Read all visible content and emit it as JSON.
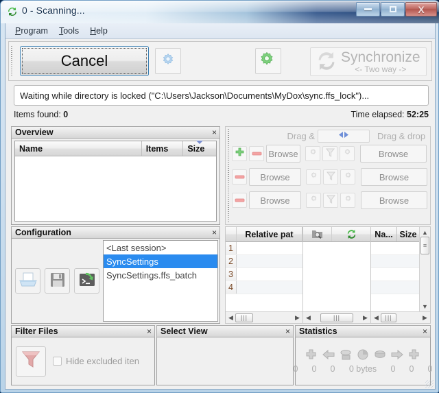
{
  "window": {
    "title": "0 - Scanning...",
    "icon": "sync-arrows-icon",
    "buttons": {
      "minimize": "minimize-button",
      "maximize": "maximize-button",
      "close_label": "X"
    }
  },
  "menubar": {
    "items": [
      {
        "label": "Program",
        "accel": "P"
      },
      {
        "label": "Tools",
        "accel": "T"
      },
      {
        "label": "Help",
        "accel": "H"
      }
    ]
  },
  "toolbar": {
    "cancel_label": "Cancel",
    "compare_settings_icon": "blue-gear-icon",
    "sync_settings_icon": "green-gear-icon",
    "synchronize_label": "Synchronize",
    "synchronize_sub": "<- Two way ->"
  },
  "status": {
    "message": "Waiting while directory is locked (\"C:\\Users\\Jackson\\Documents\\MyDox\\sync.ffs_lock\")...",
    "items_found_label": "Items found:",
    "items_found_value": "0",
    "time_elapsed_label": "Time elapsed:",
    "time_elapsed_value": "52:25"
  },
  "overview": {
    "caption": "Overview",
    "close": "×",
    "columns": [
      "Name",
      "Items",
      "Size"
    ],
    "sort_column": "Size",
    "rows": []
  },
  "dragdrop": {
    "left_hint": "Drag &",
    "right_hint": "Drag & drop",
    "swap_icon": "swap-left-right-icon",
    "rows": [
      {
        "add_icon": "green-plus-icon",
        "remove_icon": "red-minus-icon",
        "left_browse": "Browse",
        "mid_icons": [
          "gear-icon",
          "filter-icon",
          "gear-icon"
        ],
        "right_browse": "Browse"
      },
      {
        "remove_icon": "red-minus-icon",
        "left_browse": "Browse",
        "mid_icons": [
          "gear-icon",
          "filter-icon",
          "gear-icon"
        ],
        "right_browse": "Browse"
      },
      {
        "remove_icon": "red-minus-icon",
        "left_browse": "Browse",
        "mid_icons": [
          "gear-icon",
          "filter-icon",
          "gear-icon"
        ],
        "right_browse": "Browse"
      }
    ]
  },
  "configuration": {
    "caption": "Configuration",
    "close": "×",
    "buttons": [
      {
        "icon": "open-config-icon"
      },
      {
        "icon": "save-config-icon"
      },
      {
        "icon": "save-batch-job-icon"
      }
    ],
    "list": [
      {
        "label": "<Last session>",
        "selected": false
      },
      {
        "label": "SyncSettings",
        "selected": true
      },
      {
        "label": "SyncSettings.ffs_batch",
        "selected": false
      }
    ]
  },
  "grids": {
    "left": {
      "header": "Relative pat",
      "row_numbers": [
        "1",
        "2",
        "3",
        "4"
      ]
    },
    "middle": {
      "header_icons": [
        "select-folder-icon",
        "sync-direction-icon"
      ]
    },
    "right": {
      "headers": [
        "Na...",
        "Size"
      ]
    }
  },
  "filter": {
    "caption": "Filter Files",
    "close": "×",
    "icon": "funnel-filter-icon",
    "checkbox_label": "Hide excluded iten",
    "checkbox_checked": false
  },
  "selectview": {
    "caption": "Select View",
    "close": "×"
  },
  "statistics": {
    "caption": "Statistics",
    "close": "×",
    "icons": [
      "create-left-icon",
      "update-left-icon",
      "delete-left-icon",
      "data-pie-icon",
      "delete-right-icon",
      "update-right-icon",
      "create-right-icon"
    ],
    "values": [
      "0",
      "0",
      "0",
      "0 bytes",
      "0",
      "0",
      "0"
    ]
  },
  "colors": {
    "accent_selection": "#2a8bef",
    "title_dark": "#16365f",
    "green_icon": "#4caf50",
    "red_minus": "#f08a8a",
    "filter_pink": "#dba0a0"
  }
}
